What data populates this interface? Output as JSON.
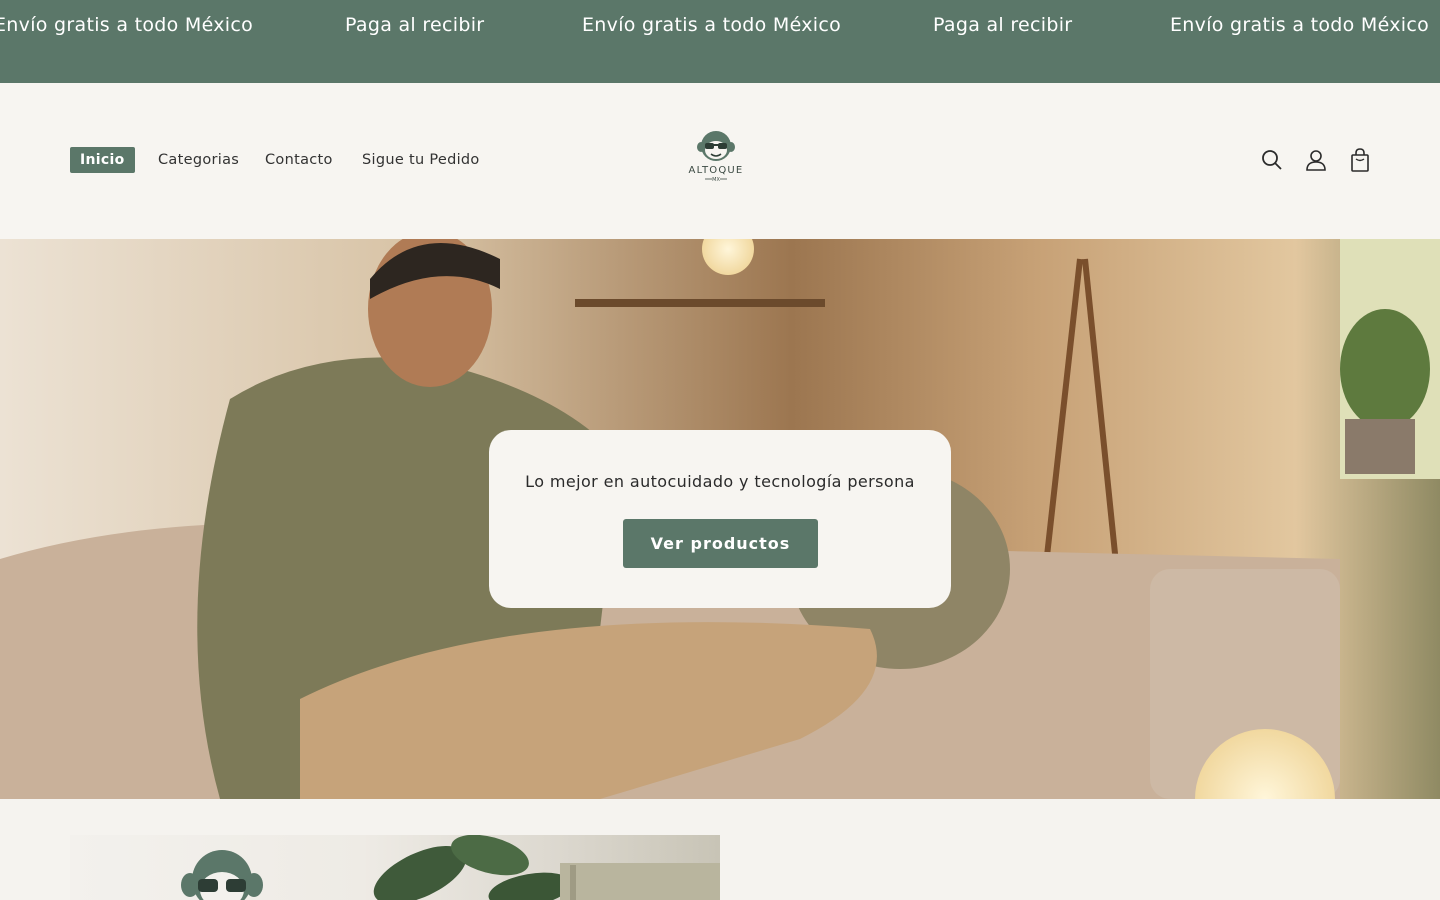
{
  "announcement": {
    "items": [
      "Envío gratis a todo México",
      "Paga al recibir",
      "Envío gratis a todo México",
      "Paga al recibir",
      "Envío gratis a todo México"
    ]
  },
  "header": {
    "nav": [
      {
        "label": "Inicio",
        "active": true
      },
      {
        "label": "Categorias",
        "active": false
      },
      {
        "label": "Contacto",
        "active": false
      },
      {
        "label": "Sigue tu Pedido",
        "active": false
      }
    ],
    "logo_text": "ALTOQUE",
    "logo_subtext": "MX",
    "icons": [
      "search-icon",
      "account-icon",
      "cart-icon"
    ]
  },
  "hero": {
    "text": "Lo mejor en autocuidado y tecnología persona",
    "button_label": "Ver productos"
  },
  "colors": {
    "brand": "#5b7769",
    "background": "#f5f3ef",
    "card": "#f7f5f1"
  }
}
